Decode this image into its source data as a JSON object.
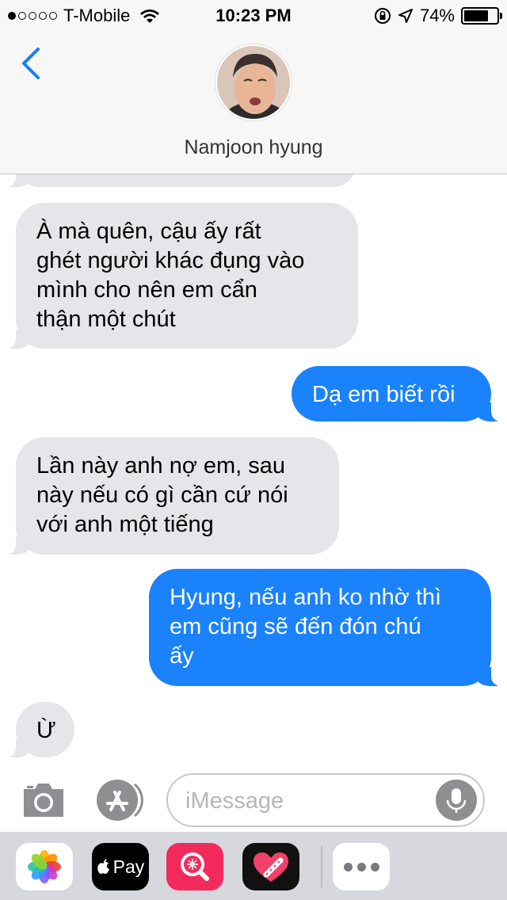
{
  "status_bar": {
    "carrier": "T-Mobile",
    "signal_bars_filled": 1,
    "signal_bars_total": 5,
    "time": "10:23 PM",
    "battery_percent": "74%",
    "battery_level": 0.74
  },
  "header": {
    "contact_name": "Namjoon hyung",
    "back_icon": "chevron-left-icon",
    "avatar_icon": "contact-photo"
  },
  "messages": [
    {
      "direction": "incoming",
      "text": "À mà quên, cậu ấy rất\nghét người khác đụng vào\nmình cho nên em cẩn\nthận một chút"
    },
    {
      "direction": "outgoing",
      "text": "Dạ em biết rồi"
    },
    {
      "direction": "incoming",
      "text": "Lần này anh nợ em, sau\nnày nếu có gì cần cứ nói\nvới anh một tiếng"
    },
    {
      "direction": "outgoing",
      "text": "Hyung, nếu anh ko nhờ thì\nem cũng sẽ đến đón chú\nấy"
    },
    {
      "direction": "incoming",
      "text": "Ừ"
    }
  ],
  "input": {
    "placeholder": "iMessage",
    "camera_icon": "camera-icon",
    "appstore_icon": "app-store-icon",
    "mic_icon": "microphone-icon"
  },
  "app_drawer": {
    "apps": [
      "photos-app-icon",
      "apple-pay-app-icon",
      "search-images-app-icon",
      "digital-touch-app-icon",
      "more-apps-icon"
    ],
    "pay_label": "Pay"
  },
  "colors": {
    "outgoing_bubble": "#1a82fb",
    "incoming_bubble": "#e5e5ea",
    "accent": "#147efb"
  }
}
